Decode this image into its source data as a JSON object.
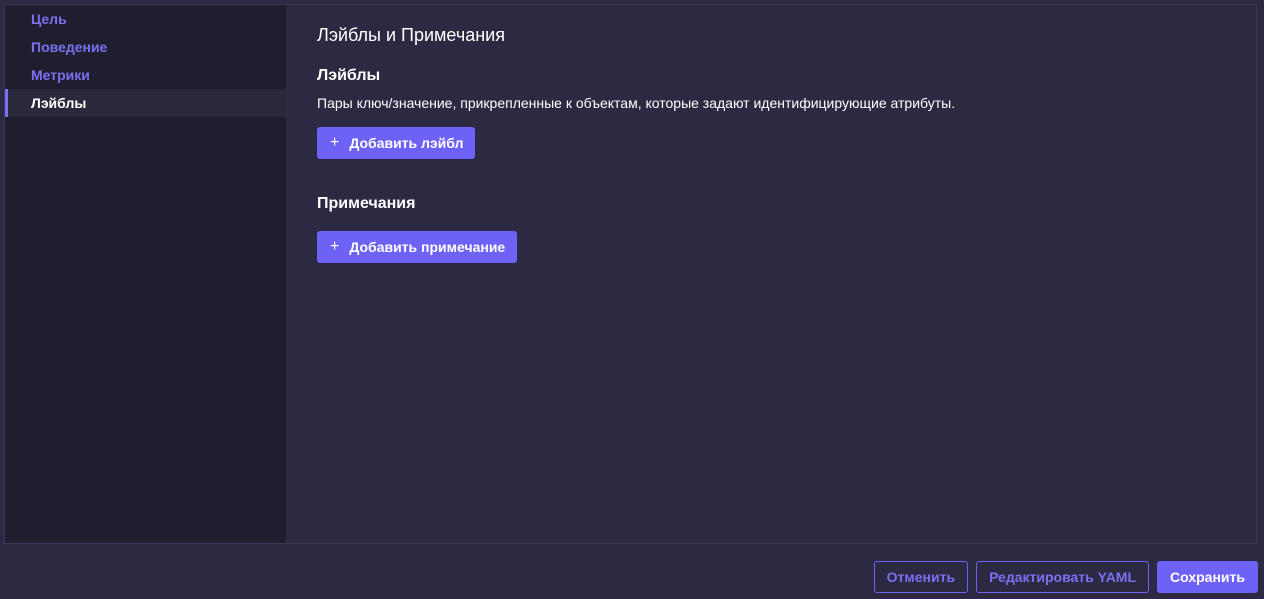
{
  "sidebar": {
    "items": [
      {
        "label": "Цель",
        "active": false
      },
      {
        "label": "Поведение",
        "active": false
      },
      {
        "label": "Метрики",
        "active": false
      },
      {
        "label": "Лэйблы",
        "active": true
      }
    ]
  },
  "main": {
    "title": "Лэйблы и Примечания",
    "labels_section": {
      "title": "Лэйблы",
      "description": "Пары ключ/значение, прикрепленные к объектам, которые задают идентифицирующие атрибуты.",
      "add_button": "Добавить лэйбл"
    },
    "notes_section": {
      "title": "Примечания",
      "add_button": "Добавить примечание"
    }
  },
  "footer": {
    "cancel_label": "Отменить",
    "edit_yaml_label": "Редактировать YAML",
    "save_label": "Сохранить"
  },
  "icons": {
    "plus": "+"
  },
  "colors": {
    "accent": "#6e61f5",
    "accent_text": "#7b6ff2",
    "background": "#2b2a42",
    "sidebar_background": "#1f1e2e"
  }
}
